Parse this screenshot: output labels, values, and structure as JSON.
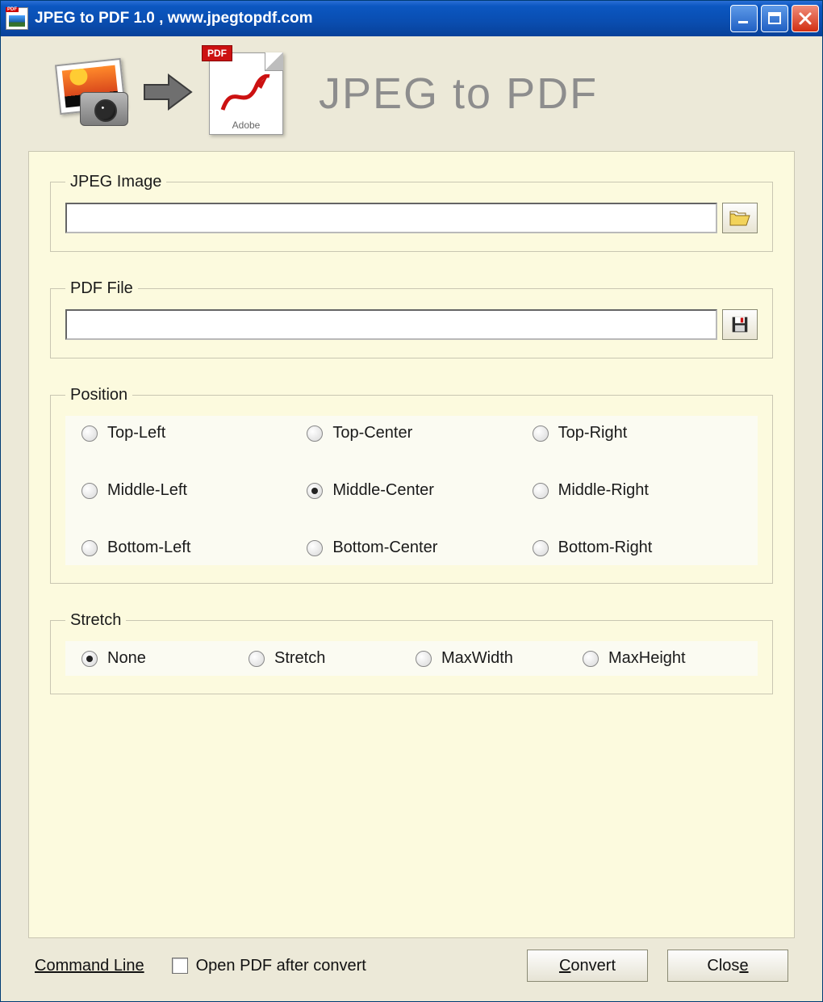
{
  "window": {
    "title": "JPEG to PDF 1.0 , www.jpegtopdf.com"
  },
  "banner": {
    "pdf_badge": "PDF",
    "adobe_label": "Adobe",
    "title": "JPEG to PDF"
  },
  "groups": {
    "jpeg": {
      "legend": "JPEG Image",
      "value": ""
    },
    "pdf": {
      "legend": "PDF File",
      "value": ""
    },
    "position": {
      "legend": "Position",
      "options": [
        "Top-Left",
        "Top-Center",
        "Top-Right",
        "Middle-Left",
        "Middle-Center",
        "Middle-Right",
        "Bottom-Left",
        "Bottom-Center",
        "Bottom-Right"
      ],
      "selected": "Middle-Center"
    },
    "stretch": {
      "legend": "Stretch",
      "options": [
        "None",
        "Stretch",
        "MaxWidth",
        "MaxHeight"
      ],
      "selected": "None"
    }
  },
  "footer": {
    "command_line": "Command Line",
    "open_after": "Open PDF after convert",
    "open_after_checked": false,
    "convert": "Convert",
    "convert_accel": "C",
    "close": "Close",
    "close_accel": "e"
  }
}
